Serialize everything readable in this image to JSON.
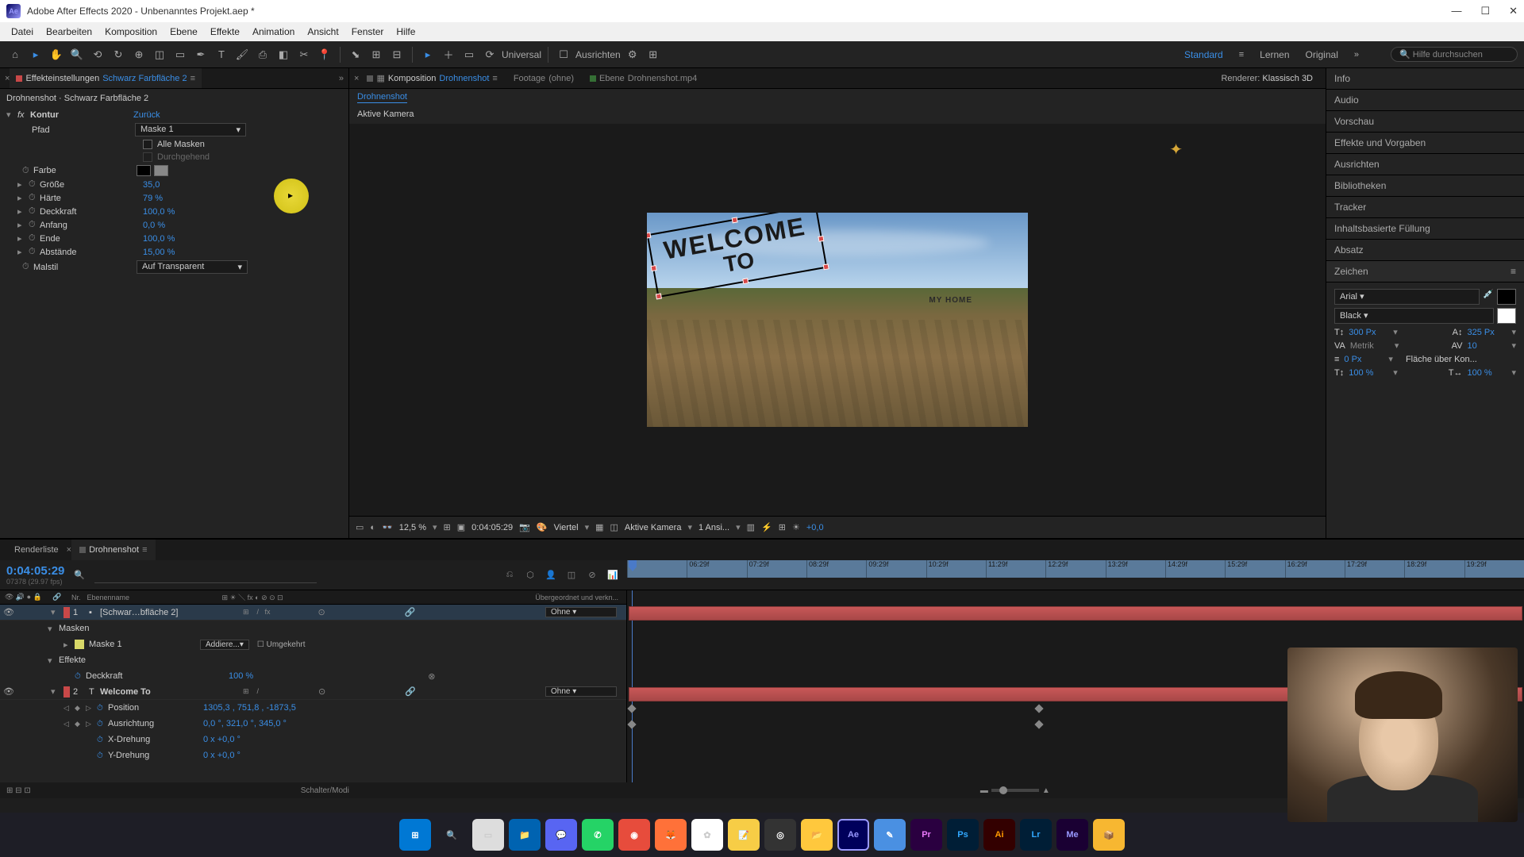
{
  "titlebar": {
    "title": "Adobe After Effects 2020 - Unbenanntes Projekt.aep *"
  },
  "menu": {
    "items": [
      "Datei",
      "Bearbeiten",
      "Komposition",
      "Ebene",
      "Effekte",
      "Animation",
      "Ansicht",
      "Fenster",
      "Hilfe"
    ]
  },
  "toolbar": {
    "ausrichten_label": "Ausrichten",
    "universal_label": "Universal",
    "workspaces": {
      "standard": "Standard",
      "lernen": "Lernen",
      "original": "Original"
    },
    "search_placeholder": "Hilfe durchsuchen"
  },
  "effect_panel": {
    "tab_label": "Effekteinstellungen",
    "tab_layer": "Schwarz Farbfläche 2",
    "breadcrumb": "Drohnenshot · Schwarz Farbfläche 2",
    "effect_name": "Kontur",
    "reset": "Zurück",
    "props": {
      "pfad": "Pfad",
      "pfad_value": "Maske 1",
      "alle_masken": "Alle Masken",
      "durchgehend": "Durchgehend",
      "farbe": "Farbe",
      "groesse": "Größe",
      "groesse_val": "35,0",
      "haerte": "Härte",
      "haerte_val": "79 %",
      "deckkraft": "Deckkraft",
      "deckkraft_val": "100,0 %",
      "anfang": "Anfang",
      "anfang_val": "0,0 %",
      "ende": "Ende",
      "ende_val": "100,0 %",
      "abstaende": "Abstände",
      "abstaende_val": "15,00 %",
      "malstil": "Malstil",
      "malstil_val": "Auf Transparent"
    }
  },
  "viewer": {
    "tabs": {
      "komposition": "Komposition",
      "komposition_name": "Drohnenshot",
      "footage": "Footage",
      "footage_value": "(ohne)",
      "ebene": "Ebene",
      "ebene_name": "Drohnenshot.mp4"
    },
    "renderer_label": "Renderer:",
    "renderer_value": "Klassisch 3D",
    "breadcrumb": "Drohnenshot",
    "camera": "Aktive Kamera",
    "text_welcome": "WELCOME",
    "text_to": "TO",
    "text_myhome": "MY HOME",
    "bottom": {
      "zoom": "12,5 %",
      "time": "0:04:05:29",
      "quality": "Viertel",
      "camera": "Aktive Kamera",
      "views": "1 Ansi...",
      "exposure": "+0,0"
    }
  },
  "right_panel": {
    "sections": [
      "Info",
      "Audio",
      "Vorschau",
      "Effekte und Vorgaben",
      "Ausrichten",
      "Bibliotheken",
      "Tracker",
      "Inhaltsbasierte Füllung",
      "Absatz"
    ],
    "zeichen": "Zeichen",
    "char": {
      "font": "Arial",
      "style": "Black",
      "size": "300 Px",
      "leading": "325 Px",
      "kerning": "Metrik",
      "tracking": "10",
      "stroke": "0 Px",
      "stroke_mode": "Fläche über Kon...",
      "vscale": "100 %",
      "hscale": "100 %"
    }
  },
  "timeline": {
    "render_tab": "Renderliste",
    "comp_tab": "Drohnenshot",
    "timecode": "0:04:05:29",
    "timecode_sub": "07378 (29.97 fps)",
    "col_headers": {
      "nr": "Nr.",
      "name": "Ebenenname",
      "parent": "Übergeordnet und verkn..."
    },
    "ruler": [
      "06:29f",
      "07:29f",
      "08:29f",
      "09:29f",
      "10:29f",
      "11:29f",
      "12:29f",
      "13:29f",
      "14:29f",
      "15:29f",
      "16:29f",
      "17:29f",
      "18:29f",
      "19:29f"
    ],
    "layers": [
      {
        "num": "1",
        "name": "[Schwar…bfläche 2]",
        "color": "#c84848",
        "parent": "Ohne",
        "children": [
          {
            "name": "Masken",
            "children": [
              {
                "name": "Maske 1",
                "mode": "Addiere...",
                "invert": "Umgekehrt"
              }
            ]
          },
          {
            "name": "Effekte",
            "children": [
              {
                "name": "Deckkraft",
                "value": "100 %"
              }
            ]
          }
        ]
      },
      {
        "num": "2",
        "name": "Welcome To",
        "color": "#c84848",
        "parent": "Ohne",
        "props": [
          {
            "name": "Position",
            "value": "1305,3 , 751,8 , -1873,5"
          },
          {
            "name": "Ausrichtung",
            "value": "0,0 °, 321,0 °, 345,0 °"
          },
          {
            "name": "X-Drehung",
            "value": "0 x +0,0 °"
          },
          {
            "name": "Y-Drehung",
            "value": "0 x +0,0 °"
          }
        ]
      }
    ],
    "footer_label": "Schalter/Modi"
  }
}
